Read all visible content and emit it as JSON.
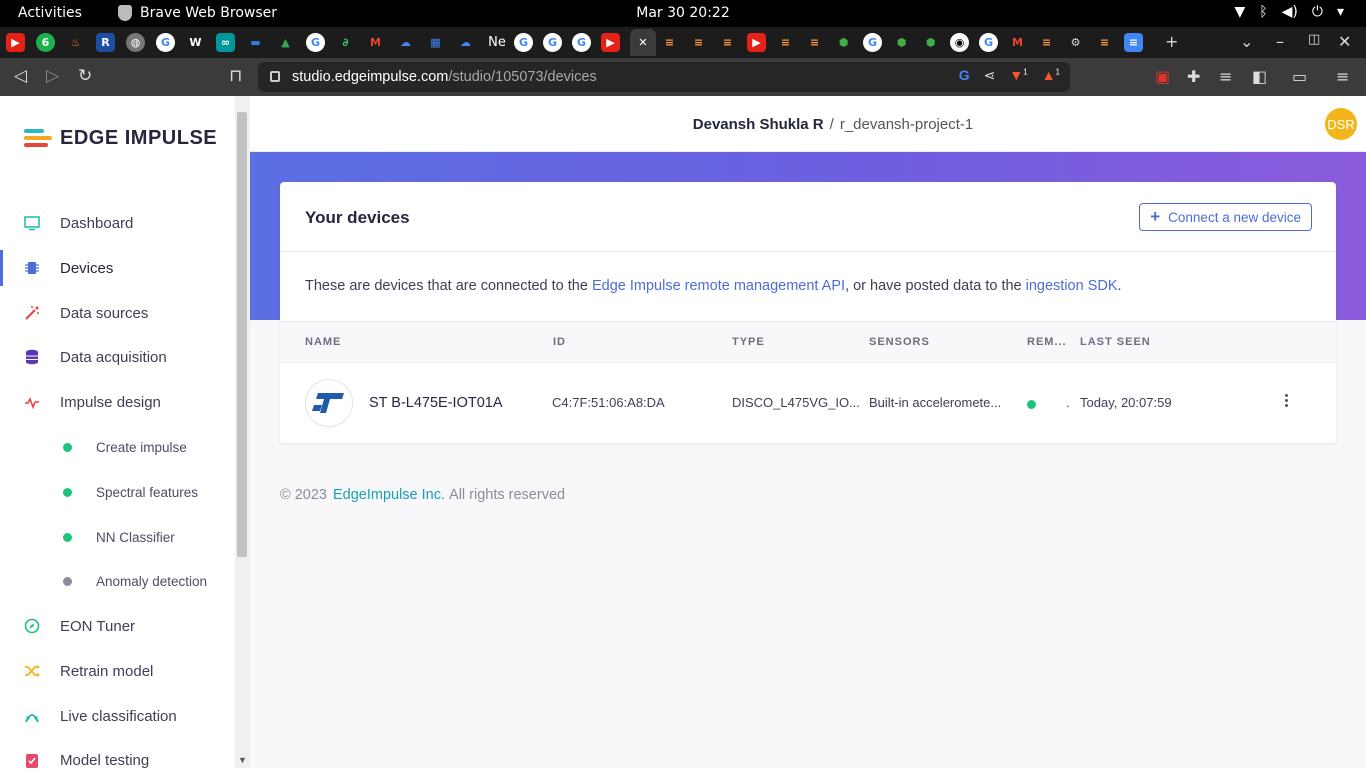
{
  "os": {
    "activities": "Activities",
    "app_name": "Brave Web Browser",
    "clock": "Mar 30  20:22"
  },
  "browser": {
    "url_host": "studio.edgeimpulse.com",
    "url_path": "/studio/105073/devices",
    "shields_count": "1",
    "rewards_count": "1",
    "tab_partial_label": "Ne"
  },
  "sidebar": {
    "logo": "EDGE IMPULSE",
    "items": [
      {
        "label": "Dashboard"
      },
      {
        "label": "Devices"
      },
      {
        "label": "Data sources"
      },
      {
        "label": "Data acquisition"
      },
      {
        "label": "Impulse design"
      },
      {
        "label": "EON Tuner"
      },
      {
        "label": "Retrain model"
      },
      {
        "label": "Live classification"
      },
      {
        "label": "Model testing"
      }
    ],
    "subitems": [
      {
        "label": "Create impulse",
        "color": "#1bc47d"
      },
      {
        "label": "Spectral features",
        "color": "#1bc47d"
      },
      {
        "label": "NN Classifier",
        "color": "#1bc47d"
      },
      {
        "label": "Anomaly detection",
        "color": "#8a8c9c"
      }
    ]
  },
  "header": {
    "user": "Devansh Shukla R",
    "separator": "/",
    "project": "r_devansh-project-1",
    "avatar": "DSR"
  },
  "devices": {
    "title": "Your devices",
    "connect_label": "Connect a new device",
    "desc_before": "These are devices that are connected to the ",
    "desc_link1": "Edge Impulse remote management API",
    "desc_middle": ", or have posted data to the ",
    "desc_link2": "ingestion SDK",
    "desc_after": ".",
    "columns": [
      "NAME",
      "ID",
      "TYPE",
      "SENSORS",
      "REM...",
      "LAST SEEN"
    ],
    "rows": [
      {
        "name": "ST B-L475E-IOT01A",
        "id": "C4:7F:51:06:A8:DA",
        "type": "DISCO_L475VG_IO...",
        "sensors": "Built-in acceleromete...",
        "remote_extra": ".",
        "last_seen": "Today, 20:07:59"
      }
    ]
  },
  "footer": {
    "copyright": "© 2023",
    "company": "EdgeImpulse Inc.",
    "rights": "All rights reserved"
  },
  "colors": {
    "accent": "#4d6cd6",
    "hero_start": "#5b6fe2",
    "hero_end": "#8b5bdd",
    "online": "#1bc47d",
    "avatar": "#f2b51c"
  }
}
